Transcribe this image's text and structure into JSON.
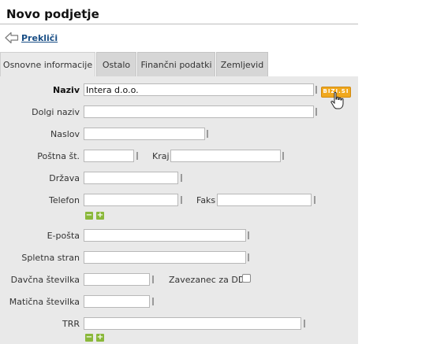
{
  "page": {
    "title": "Novo podjetje"
  },
  "nav": {
    "back_label": "Prekliči"
  },
  "tabs": [
    {
      "label": "Osnovne informacije",
      "active": true
    },
    {
      "label": "Ostalo",
      "active": false
    },
    {
      "label": "Finančni podatki",
      "active": false
    },
    {
      "label": "Zemljevid",
      "active": false
    }
  ],
  "form": {
    "naziv": {
      "label": "Naziv",
      "value": "Intera d.o.o."
    },
    "choose_button": "BIZI.SI",
    "dolgi_naziv": {
      "label": "Dolgi naziv",
      "value": ""
    },
    "naslov": {
      "label": "Naslov",
      "value": ""
    },
    "postna": {
      "label": "Poštna št.",
      "value": ""
    },
    "kraj": {
      "label": "Kraj",
      "value": ""
    },
    "drzava": {
      "label": "Država",
      "value": ""
    },
    "telefon": {
      "label": "Telefon",
      "value": ""
    },
    "faks": {
      "label": "Faks",
      "value": ""
    },
    "eposta": {
      "label": "E-pošta",
      "value": ""
    },
    "spletna": {
      "label": "Spletna stran",
      "value": ""
    },
    "davcna": {
      "label": "Davčna številka",
      "value": ""
    },
    "ddv": {
      "label": "Zavezanec za DDV",
      "checked": false
    },
    "maticna": {
      "label": "Matična številka",
      "value": ""
    },
    "trr": {
      "label": "TRR",
      "value": ""
    }
  },
  "icons": {
    "back": "arrow-left-icon",
    "remove": "minus-icon",
    "add": "plus-icon",
    "cursor": "hand-pointer-icon"
  },
  "colors": {
    "link": "#1a4f86",
    "panel": "#e9e9e9",
    "tab_inactive": "#d6d6d6",
    "add_remove": "#8ab83a",
    "choose_button": "#f0a81e"
  }
}
